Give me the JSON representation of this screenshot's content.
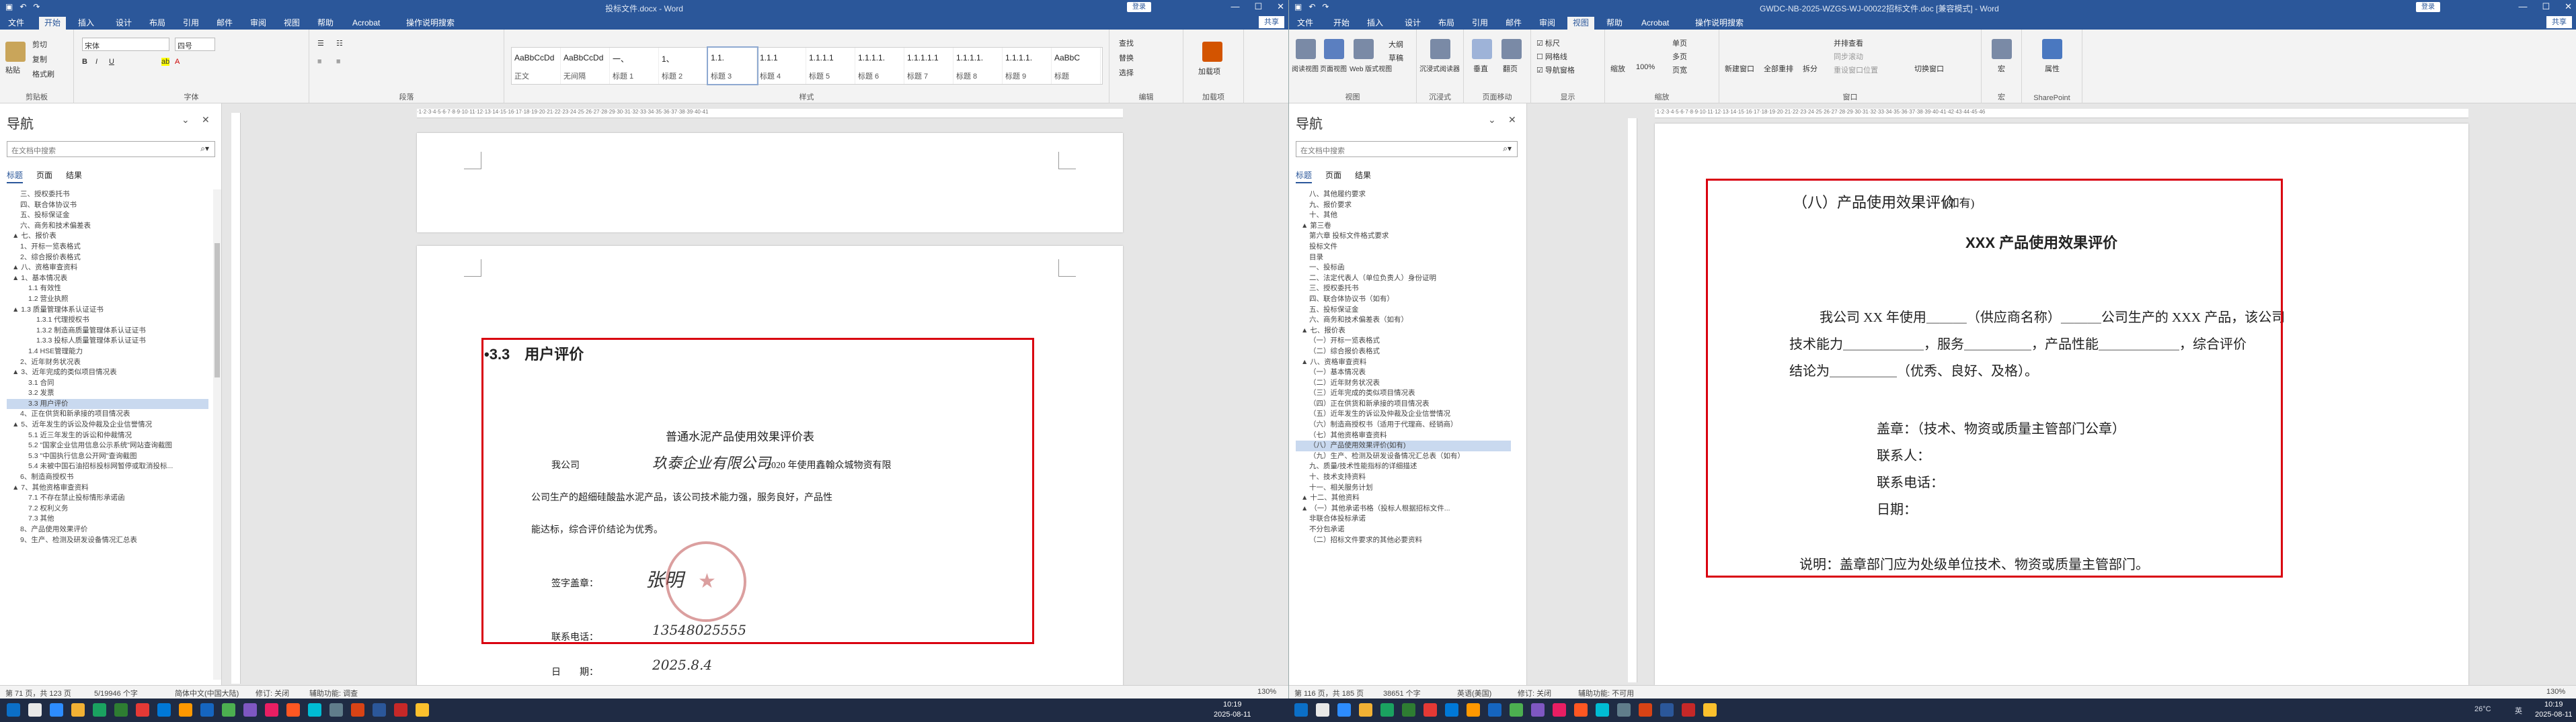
{
  "left": {
    "title": "投标文件.docx - Word",
    "login": "登录",
    "share": "共享",
    "tabs": [
      "文件",
      "开始",
      "插入",
      "设计",
      "布局",
      "引用",
      "邮件",
      "审阅",
      "视图",
      "帮助",
      "Acrobat",
      "操作说明搜索"
    ],
    "ribbon": {
      "clipboard": {
        "label": "剪贴板",
        "paste": "粘贴",
        "cut": "剪切",
        "copy": "复制",
        "painter": "格式刷"
      },
      "font": {
        "label": "字体",
        "name": "宋体",
        "size": "四号"
      },
      "paragraph": {
        "label": "段落"
      },
      "styles": {
        "label": "样式",
        "items": [
          {
            "preview": "AaBbCcDd",
            "name": "正文"
          },
          {
            "preview": "AaBbCcDd",
            "name": "无间隔"
          },
          {
            "preview": "一、",
            "name": "标题 1"
          },
          {
            "preview": "1、",
            "name": "标题 2"
          },
          {
            "preview": "1.1.",
            "name": "标题 3"
          },
          {
            "preview": "1.1.1",
            "name": "标题 4"
          },
          {
            "preview": "1.1.1.1",
            "name": "标题 5"
          },
          {
            "preview": "1.1.1.1.",
            "name": "标题 6"
          },
          {
            "preview": "1.1.1.1.1",
            "name": "标题 7"
          },
          {
            "preview": "1.1.1.1.",
            "name": "标题 8"
          },
          {
            "preview": "1.1.1.1.",
            "name": "标题 9"
          },
          {
            "preview": "AaBbC",
            "name": "标题"
          }
        ]
      },
      "editing": {
        "label": "编辑",
        "find": "查找",
        "replace": "替换",
        "select": "选择"
      },
      "addin": {
        "label": "加载项",
        "name": "加载项"
      }
    },
    "nav": {
      "title": "导航",
      "search_placeholder": "在文档中搜索",
      "tabs": [
        "标题",
        "页面",
        "结果"
      ],
      "items": [
        "三、授权委托书",
        "四、联合体协议书",
        "五、投标保证金",
        "六、商务和技术偏差表",
        "▲ 七、报价表",
        "1、开标一览表格式",
        "2、综合报价表格式",
        "▲ 八、资格审查资料",
        "▲ 1、基本情况表",
        "1.1 有效性",
        "1.2 营业执照",
        "▲ 1.3 质量管理体系认证证书",
        "1.3.1 代理授权书",
        "1.3.2 制造商质量管理体系认证证书",
        "1.3.3 投标人质量管理体系认证证书",
        "1.4 HSE管理能力",
        "2、近年财务状况表",
        "▲ 3、近年完成的类似项目情况表",
        "3.1 合同",
        "3.2 发票",
        "3.3 用户评价",
        "4、正在供货和新承接的项目情况表",
        "▲ 5、近年发生的诉讼及仲裁及企业信誉情况",
        "5.1 近三年发生的诉讼和仲裁情况",
        "5.2 \"国家企业信用信息公示系统\"网站查询截图",
        "5.3 \"中国执行信息公开网\"查询截图",
        "5.4 未被中国石油招标投标网暂停或取消投标...",
        "6、制造商授权书",
        "▲ 7、其他资格审查资料",
        "7.1 不存在禁止投标情形承诺函",
        "7.2 权利义务",
        "7.3 其他",
        "8、产品使用效果评价",
        "9、生产、检测及研发设备情况汇总表"
      ],
      "selected": 20
    },
    "page": {
      "heading": "•3.3　用户评价",
      "form_title": "普通水泥产品使用效果评价表",
      "line1_a": "我公司",
      "line1_sign": "玖泰企业有限公司",
      "line1_b": "2020 年使用鑫翰众城物资有限",
      "line2": "公司生产的超细硅酸盐水泥产品，该公司技术能力强，服务良好，产品性",
      "line3": "能达标，综合评价结论为优秀。",
      "signer": "签字盖章：",
      "signer_sign": "张明",
      "phone": "联系电话：",
      "phone_val": "13548025555",
      "date": "日　　期：",
      "date_val": "2025.8.4"
    },
    "status": {
      "page": "第 71 页，共 123 页",
      "words": "5/19946 个字",
      "lang": "简体中文(中国大陆)",
      "track": "修订: 关闭",
      "access": "辅助功能: 调查",
      "zoom": "130%"
    }
  },
  "right": {
    "title": "GWDC-NB-2025-WZGS-WJ-00022招标文件.doc [兼容模式] - Word",
    "login": "登录",
    "share": "共享",
    "tabs": [
      "文件",
      "开始",
      "插入",
      "设计",
      "布局",
      "引用",
      "邮件",
      "审阅",
      "视图",
      "帮助",
      "Acrobat",
      "操作说明搜索"
    ],
    "ribbon": {
      "views": {
        "label": "视图",
        "items": [
          "阅读视图",
          "页面视图",
          "Web 版式视图"
        ],
        "side": [
          "大纲",
          "草稿"
        ]
      },
      "immersive": {
        "label": "沉浸式",
        "item": "沉浸式阅读器"
      },
      "pagemove": {
        "label": "页面移动",
        "items": [
          "垂直",
          "翻页"
        ]
      },
      "show": {
        "label": "显示",
        "items": [
          "标尺",
          "网格线",
          "导航窗格"
        ]
      },
      "zoom": {
        "label": "缩放",
        "items": [
          "缩放",
          "100%",
          "单页",
          "多页",
          "页宽"
        ]
      },
      "window": {
        "label": "窗口",
        "items": [
          "新建窗口",
          "全部重排",
          "拆分",
          "并排查看",
          "同步滚动",
          "重设窗口位置",
          "切换窗口"
        ]
      },
      "macro": {
        "label": "宏",
        "item": "宏"
      },
      "sp": {
        "label": "SharePoint",
        "item": "属性"
      }
    },
    "nav": {
      "title": "导航",
      "search_placeholder": "在文档中搜索",
      "tabs": [
        "标题",
        "页面",
        "结果"
      ],
      "items": [
        "八、其他履约要求",
        "九、报价要求",
        "十、其他",
        "▲ 第三卷",
        "第六章 投标文件格式要求",
        "投标文件",
        "目录",
        "一、投标函",
        "二、法定代表人（单位负责人）身份证明",
        "三、授权委托书",
        "四、联合体协议书（如有）",
        "五、投标保证金",
        "六、商务和技术偏差表（如有）",
        "▲ 七、报价表",
        "（一）开标一览表格式",
        "（二）综合报价表格式",
        "▲ 八、资格审查资料",
        "（一）基本情况表",
        "（二）近年财务状况表",
        "（三）近年完成的类似项目情况表",
        "（四）正在供货和新承接的项目情况表",
        "（五）近年发生的诉讼及仲裁及企业信誉情况",
        "（六）制造商授权书（适用于代理商、经销商）",
        "（七）其他资格审查资料",
        "（八）产品使用效果评价(如有)",
        "（九）生产、检测及研发设备情况汇总表（如有）",
        "九、质量/技术性能指标的详细描述",
        "十、技术支持资料",
        "十一、相关服务计划",
        "▲ 十二、其他资料",
        "▲ （一）其他承诺书格（投标人根据招标文件...",
        "非联合体投标承诺",
        "不分包承诺",
        "（二）招标文件要求的其他必要资料"
      ],
      "selected": 24
    },
    "page": {
      "heading_a": "（八）产品使用效果评价",
      "heading_b": "(如有)",
      "title": "XXX 产品使用效果评价",
      "p1": "我公司 XX 年使用＿＿＿（供应商名称）＿＿＿公司生产的 XXX 产品，该公司",
      "p2": "技术能力＿＿＿＿＿＿，服务＿＿＿＿＿，产品性能＿＿＿＿＿＿，综合评价",
      "p3": "结论为＿＿＿＿＿（优秀、良好、及格）。",
      "stamp": "盖章：（技术、物资或质量主管部门公章）",
      "contact": "联系人：",
      "phone": "联系电话：",
      "date": "日期：",
      "note": "说明：盖章部门应为处级单位技术、物资或质量主管部门。"
    },
    "status": {
      "page": "第 116 页，共 185 页",
      "words": "38651 个字",
      "lang": "英语(美国)",
      "track": "修订: 关闭",
      "access": "辅助功能: 不可用",
      "zoom": "130%"
    }
  },
  "taskbar": {
    "time_left": "10:19",
    "date_left": "2025-08-11",
    "time_right": "10:19",
    "date_right": "2025-08-11",
    "lang": "英",
    "temp": "26°C"
  }
}
